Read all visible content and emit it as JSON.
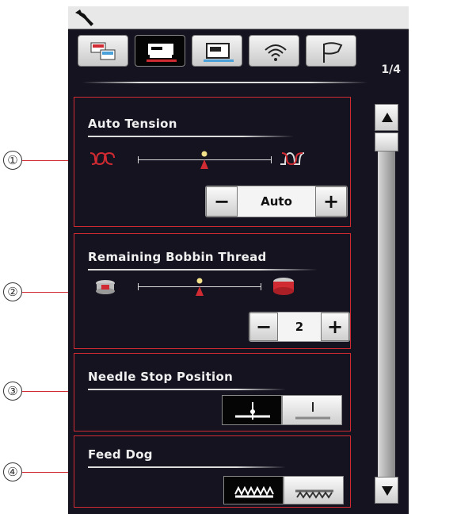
{
  "page_indicator": "1/4",
  "tabs": [
    {
      "icon": "machine-settings-icon",
      "active": false
    },
    {
      "icon": "sewing-machine-icon",
      "active": true
    },
    {
      "icon": "embroidery-machine-icon",
      "active": false
    },
    {
      "icon": "wireless-icon",
      "active": false
    },
    {
      "icon": "flag-icon",
      "active": false
    }
  ],
  "callouts": [
    "①",
    "②",
    "③",
    "④"
  ],
  "auto_tension": {
    "title": "Auto Tension",
    "value": "Auto",
    "minus": "−",
    "plus": "+",
    "slider_level": 0.5
  },
  "bobbin": {
    "title": "Remaining Bobbin Thread",
    "value": "2",
    "minus": "−",
    "plus": "+",
    "slider_level": 0.5
  },
  "needle_stop": {
    "title": "Needle Stop Position",
    "selected": "down"
  },
  "feed_dog": {
    "title": "Feed Dog",
    "selected": "up"
  },
  "colors": {
    "accent_red": "#d02a33",
    "background": "#14131f"
  }
}
